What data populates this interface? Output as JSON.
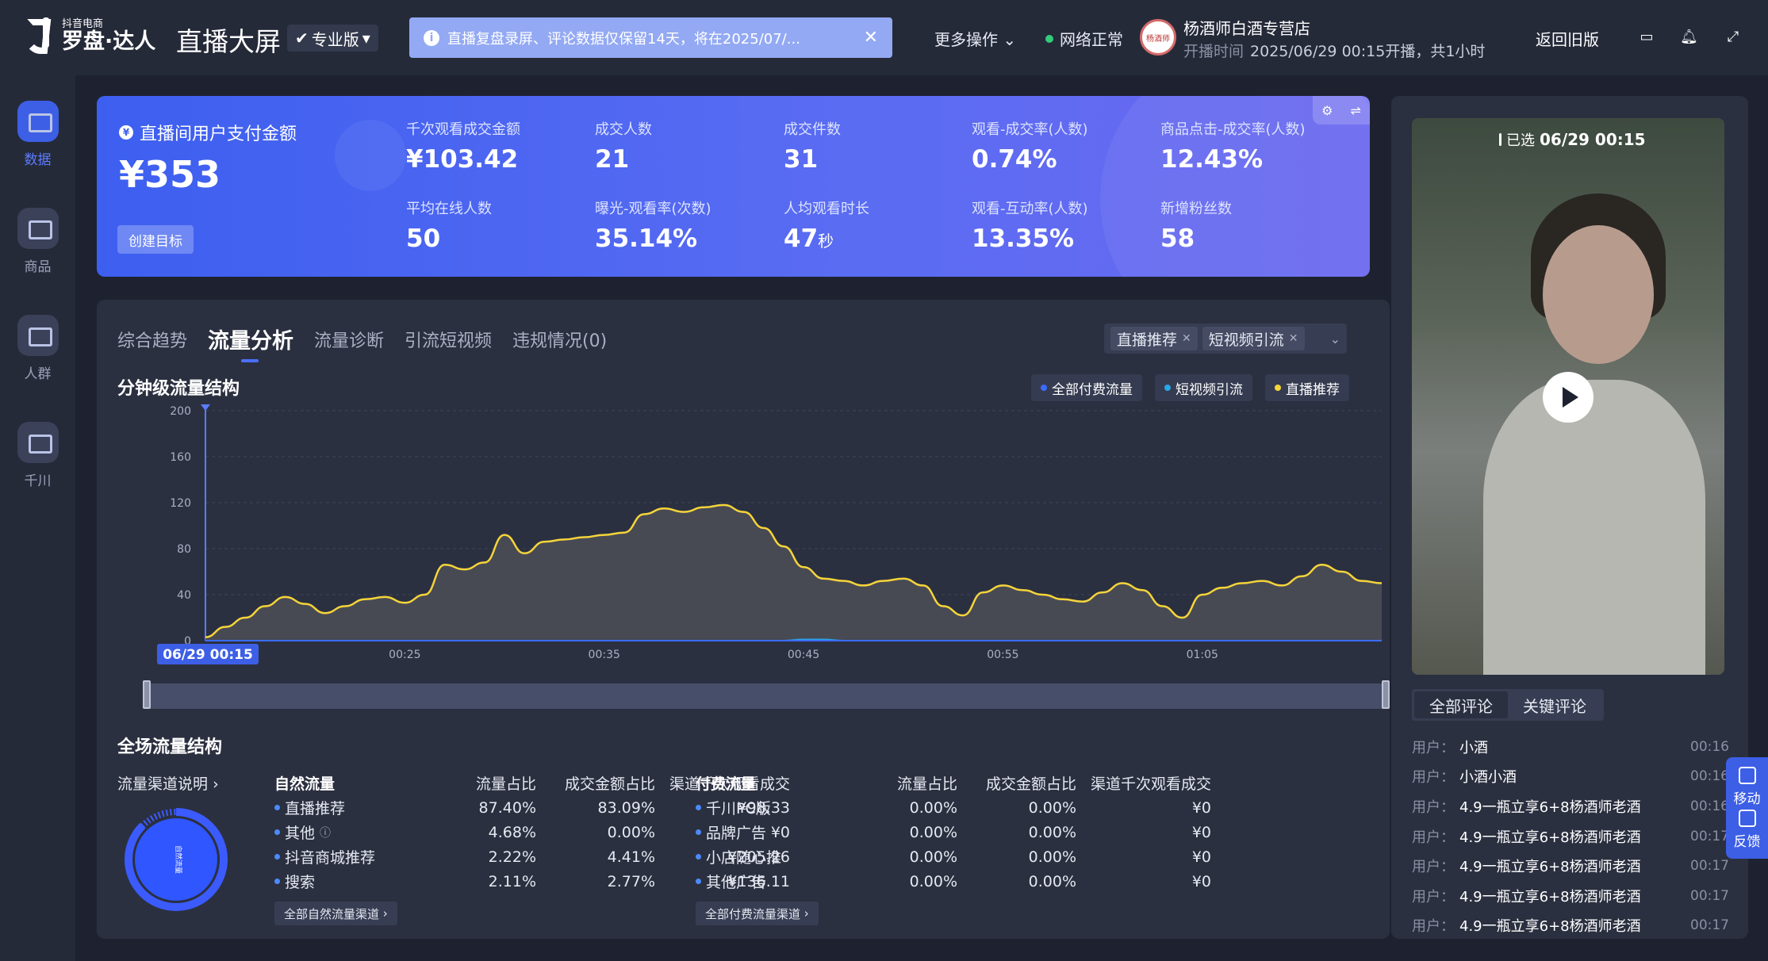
{
  "header": {
    "logo_small": "抖音电商",
    "logo_large": "罗盘·达人",
    "title": "直播大屏",
    "edition": "专业版",
    "notice": "直播复盘录屏、评论数据仅保留14天，将在2025/07/...",
    "more_ops": "更多操作",
    "network": "网络正常",
    "shop_name": "杨酒师白酒专营店",
    "shop_avatar_text": "杨酒师",
    "open_label": "开播时间",
    "open_time": "2025/06/29 00:15开播，共1小时",
    "back_old": "返回旧版"
  },
  "nav": [
    {
      "label": "数据",
      "active": true
    },
    {
      "label": "商品",
      "active": false
    },
    {
      "label": "人群",
      "active": false
    },
    {
      "label": "千川",
      "active": false
    }
  ],
  "stats": {
    "pay_title": "直播间用户支付金额",
    "pay_value": "¥353",
    "create_goal": "创建目标",
    "metrics": [
      {
        "label": "千次观看成交金额",
        "value": "¥103.42",
        "unit": ""
      },
      {
        "label": "成交人数",
        "value": "21",
        "unit": ""
      },
      {
        "label": "成交件数",
        "value": "31",
        "unit": ""
      },
      {
        "label": "观看-成交率(人数)",
        "value": "0.74%",
        "unit": ""
      },
      {
        "label": "商品点击-成交率(人数)",
        "value": "12.43%",
        "unit": ""
      },
      {
        "label": "平均在线人数",
        "value": "50",
        "unit": ""
      },
      {
        "label": "曝光-观看率(次数)",
        "value": "35.14%",
        "unit": ""
      },
      {
        "label": "人均观看时长",
        "value": "47",
        "unit": "秒"
      },
      {
        "label": "观看-互动率(人数)",
        "value": "13.35%",
        "unit": ""
      },
      {
        "label": "新增粉丝数",
        "value": "58",
        "unit": ""
      }
    ]
  },
  "tabs": [
    {
      "label": "综合趋势",
      "active": false
    },
    {
      "label": "流量分析",
      "active": true
    },
    {
      "label": "流量诊断",
      "active": false
    },
    {
      "label": "引流短视频",
      "active": false
    },
    {
      "label": "违规情况(0)",
      "active": false
    }
  ],
  "filters": [
    "直播推荐",
    "短视频引流"
  ],
  "chart_section_title": "分钟级流量结构",
  "chart_data": {
    "type": "area",
    "ylim": [
      0,
      200
    ],
    "yticks": [
      0,
      40,
      80,
      120,
      160,
      200
    ],
    "xticks": [
      "00:25",
      "00:35",
      "00:45",
      "00:55",
      "01:05"
    ],
    "selected_label": "06/29 00:15",
    "legend_placement": "top-right",
    "series": [
      {
        "name": "全部付费流量",
        "color": "#3b6cff",
        "values": [
          0,
          0,
          0,
          0,
          0,
          0,
          0,
          0,
          0,
          0,
          0,
          0,
          0,
          0,
          0,
          0,
          0,
          0,
          0,
          0,
          0,
          0,
          0,
          0,
          0,
          0,
          0,
          0,
          0,
          0,
          0,
          0,
          0,
          0,
          0,
          0,
          0,
          0,
          0,
          0,
          0,
          0,
          0,
          0,
          0,
          0,
          0,
          0,
          0,
          0,
          0,
          0,
          0,
          0,
          0,
          0,
          0,
          0,
          0,
          0
        ]
      },
      {
        "name": "短视频引流",
        "color": "#29a7e8",
        "values": [
          0,
          0,
          0,
          0,
          0,
          0,
          0,
          0,
          0,
          0,
          0,
          0,
          0,
          0,
          0,
          0,
          0,
          0,
          0,
          0,
          0,
          0,
          0,
          0,
          0,
          0,
          0,
          0,
          0,
          0,
          1,
          1,
          0,
          0,
          0,
          0,
          0,
          0,
          0,
          0,
          0,
          0,
          0,
          0,
          0,
          0,
          0,
          0,
          0,
          0,
          0,
          0,
          0,
          0,
          0,
          0,
          0,
          0,
          0,
          0
        ]
      },
      {
        "name": "直播推荐",
        "color": "#f5d43a",
        "values": [
          3,
          12,
          20,
          30,
          38,
          32,
          24,
          30,
          36,
          38,
          33,
          40,
          66,
          62,
          68,
          92,
          76,
          86,
          88,
          90,
          92,
          94,
          110,
          115,
          112,
          116,
          118,
          112,
          98,
          82,
          64,
          54,
          52,
          48,
          52,
          54,
          48,
          30,
          22,
          42,
          48,
          44,
          40,
          36,
          34,
          42,
          50,
          44,
          30,
          20,
          40,
          46,
          50,
          52,
          48,
          56,
          66,
          60,
          52,
          50
        ]
      }
    ]
  },
  "legend": [
    {
      "name": "全部付费流量",
      "color": "#3b6cff"
    },
    {
      "name": "短视频引流",
      "color": "#29a7e8"
    },
    {
      "name": "直播推荐",
      "color": "#f5d43a"
    }
  ],
  "bottom": {
    "title": "全场流量结构",
    "channel_desc": "流量渠道说明",
    "donut_label": "自然流量",
    "natural": {
      "headers": [
        "自然流量",
        "流量占比",
        "成交金额占比",
        "渠道千次观看成交"
      ],
      "rows": [
        [
          "直播推荐",
          "87.40%",
          "83.09%",
          "¥98.33"
        ],
        [
          "其他",
          "4.68%",
          "0.00%",
          "¥0"
        ],
        [
          "抖音商城推荐",
          "2.22%",
          "4.41%",
          "¥205.26"
        ],
        [
          "搜索",
          "2.11%",
          "2.77%",
          "¥136.11"
        ]
      ],
      "more": "全部自然流量渠道"
    },
    "paid": {
      "headers": [
        "付费流量",
        "流量占比",
        "成交金额占比",
        "渠道千次观看成交"
      ],
      "rows": [
        [
          "千川PC版",
          "0.00%",
          "0.00%",
          "¥0"
        ],
        [
          "品牌广告",
          "0.00%",
          "0.00%",
          "¥0"
        ],
        [
          "小店随心推",
          "0.00%",
          "0.00%",
          "¥0"
        ],
        [
          "其他广告",
          "0.00%",
          "0.00%",
          "¥0"
        ]
      ],
      "more": "全部付费流量渠道"
    }
  },
  "video": {
    "badge_label": "已选",
    "badge_time": "06/29 00:15"
  },
  "comment_tabs": [
    "全部评论",
    "关键评论"
  ],
  "comments": [
    {
      "user": "用户：",
      "text": "小酒",
      "time": "00:16"
    },
    {
      "user": "用户：",
      "text": "小酒小酒",
      "time": "00:16"
    },
    {
      "user": "用户：",
      "text": "4.9一瓶立享6+8杨酒师老酒",
      "time": "00:16"
    },
    {
      "user": "用户：",
      "text": "4.9一瓶立享6+8杨酒师老酒",
      "time": "00:17"
    },
    {
      "user": "用户：",
      "text": "4.9一瓶立享6+8杨酒师老酒",
      "time": "00:17"
    },
    {
      "user": "用户：",
      "text": "4.9一瓶立享6+8杨酒师老酒",
      "time": "00:17"
    },
    {
      "user": "用户：",
      "text": "4.9一瓶立享6+8杨酒师老酒",
      "time": "00:17"
    }
  ],
  "float_tools": [
    "移动",
    "反馈"
  ]
}
